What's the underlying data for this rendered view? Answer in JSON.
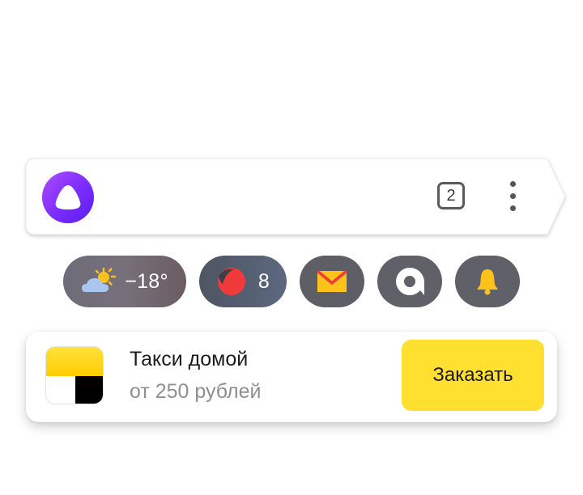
{
  "search_bar": {
    "assistant_icon": "alice-icon",
    "tabs_count": "2",
    "menu_icon": "kebab-menu-icon"
  },
  "informers": {
    "weather": {
      "icon": "partly-cloudy-icon",
      "temperature": "−18°"
    },
    "traffic": {
      "icon": "traffic-jam-icon",
      "score": "8",
      "color": "#f03a3a"
    },
    "mail": {
      "icon": "mail-icon"
    },
    "messenger": {
      "icon": "q-messenger-icon"
    },
    "notifications": {
      "icon": "bell-icon",
      "color": "#ffc21a"
    }
  },
  "promo": {
    "icon": "yandex-taxi-icon",
    "title": "Такси домой",
    "subtitle": "от 250 рублей",
    "button_label": "Заказать",
    "button_color": "#ffdf2f"
  }
}
